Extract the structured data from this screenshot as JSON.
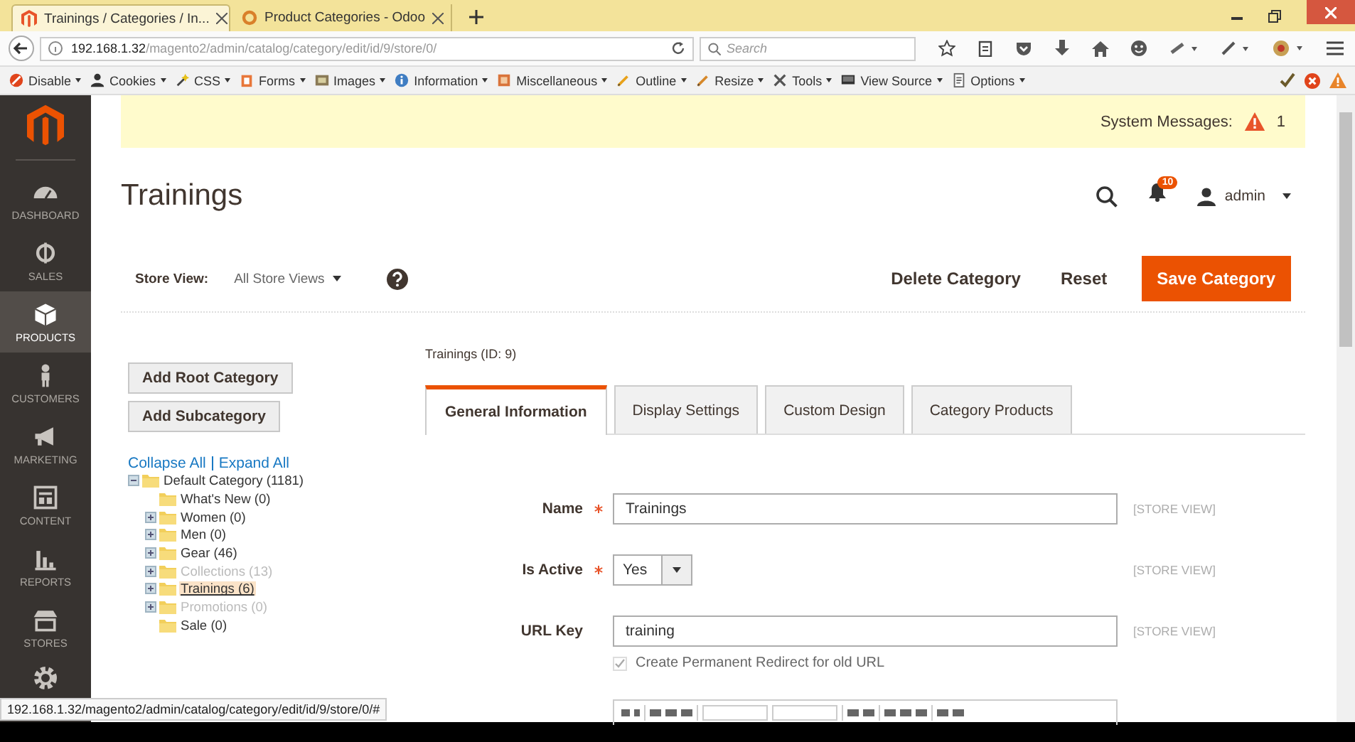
{
  "browser": {
    "tabs": [
      {
        "title": "Trainings / Categories / In...",
        "selected": true
      },
      {
        "title": "Product Categories - Odoo",
        "selected": false
      }
    ],
    "url_host": "192.168.1.32",
    "url_path": "/magento2/admin/catalog/category/edit/id/9/store/0/",
    "search": {
      "placeholder": "Search"
    }
  },
  "dev_toolbar": {
    "items": [
      "Disable",
      "Cookies",
      "CSS",
      "Forms",
      "Images",
      "Information",
      "Miscellaneous",
      "Outline",
      "Resize",
      "Tools",
      "View Source",
      "Options"
    ]
  },
  "sidebar": {
    "items": [
      {
        "label": "DASHBOARD",
        "selected": false
      },
      {
        "label": "SALES",
        "selected": false
      },
      {
        "label": "PRODUCTS",
        "selected": true
      },
      {
        "label": "CUSTOMERS",
        "selected": false
      },
      {
        "label": "MARKETING",
        "selected": false
      },
      {
        "label": "CONTENT",
        "selected": false
      },
      {
        "label": "REPORTS",
        "selected": false
      },
      {
        "label": "STORES",
        "selected": false
      }
    ]
  },
  "system_messages": {
    "label": "System Messages:",
    "count": "1"
  },
  "page_title": "Trainings",
  "header": {
    "notifications": "10",
    "user": "admin"
  },
  "store_view": {
    "label": "Store View:",
    "value": "All Store Views"
  },
  "actions": [
    {
      "label": "Delete Category",
      "kind": "link"
    },
    {
      "label": "Reset",
      "kind": "link"
    },
    {
      "label": "Save Category",
      "kind": "primary"
    }
  ],
  "category_buttons": [
    "Add Root Category",
    "Add Subcategory"
  ],
  "tree_links": [
    "Collapse All",
    "Expand All"
  ],
  "tree": [
    {
      "label": "Default Category (1181)",
      "expanded": true,
      "disabled": false,
      "selected": false,
      "children": [
        {
          "label": "What's New (0)",
          "expandable": false,
          "disabled": false,
          "selected": false
        },
        {
          "label": "Women (0)",
          "expandable": true,
          "disabled": false,
          "selected": false
        },
        {
          "label": "Men (0)",
          "expandable": true,
          "disabled": false,
          "selected": false
        },
        {
          "label": "Gear (46)",
          "expandable": true,
          "disabled": false,
          "selected": false
        },
        {
          "label": "Collections (13)",
          "expandable": true,
          "disabled": true,
          "selected": false
        },
        {
          "label": "Trainings (6)",
          "expandable": true,
          "disabled": false,
          "selected": true
        },
        {
          "label": "Promotions (0)",
          "expandable": true,
          "disabled": true,
          "selected": false
        },
        {
          "label": "Sale (0)",
          "expandable": false,
          "disabled": false,
          "selected": false
        }
      ]
    }
  ],
  "category_heading": "Trainings (ID: 9)",
  "tabs": [
    {
      "label": "General Information",
      "selected": true
    },
    {
      "label": "Display Settings",
      "selected": false
    },
    {
      "label": "Custom Design",
      "selected": false
    },
    {
      "label": "Category Products",
      "selected": false
    }
  ],
  "fields": [
    {
      "kind": "text",
      "label": "Name",
      "required": true,
      "value": "Trainings",
      "scope": "[STORE VIEW]"
    },
    {
      "kind": "select",
      "label": "Is Active",
      "required": true,
      "value": "Yes",
      "scope": "[STORE VIEW]"
    },
    {
      "kind": "text",
      "label": "URL Key",
      "required": false,
      "value": "training",
      "scope": "[STORE VIEW]",
      "option": {
        "label": "Create Permanent Redirect for old URL",
        "checked": true
      }
    }
  ],
  "status_link": "192.168.1.32/magento2/admin/catalog/category/edit/id/9/store/0/#"
}
